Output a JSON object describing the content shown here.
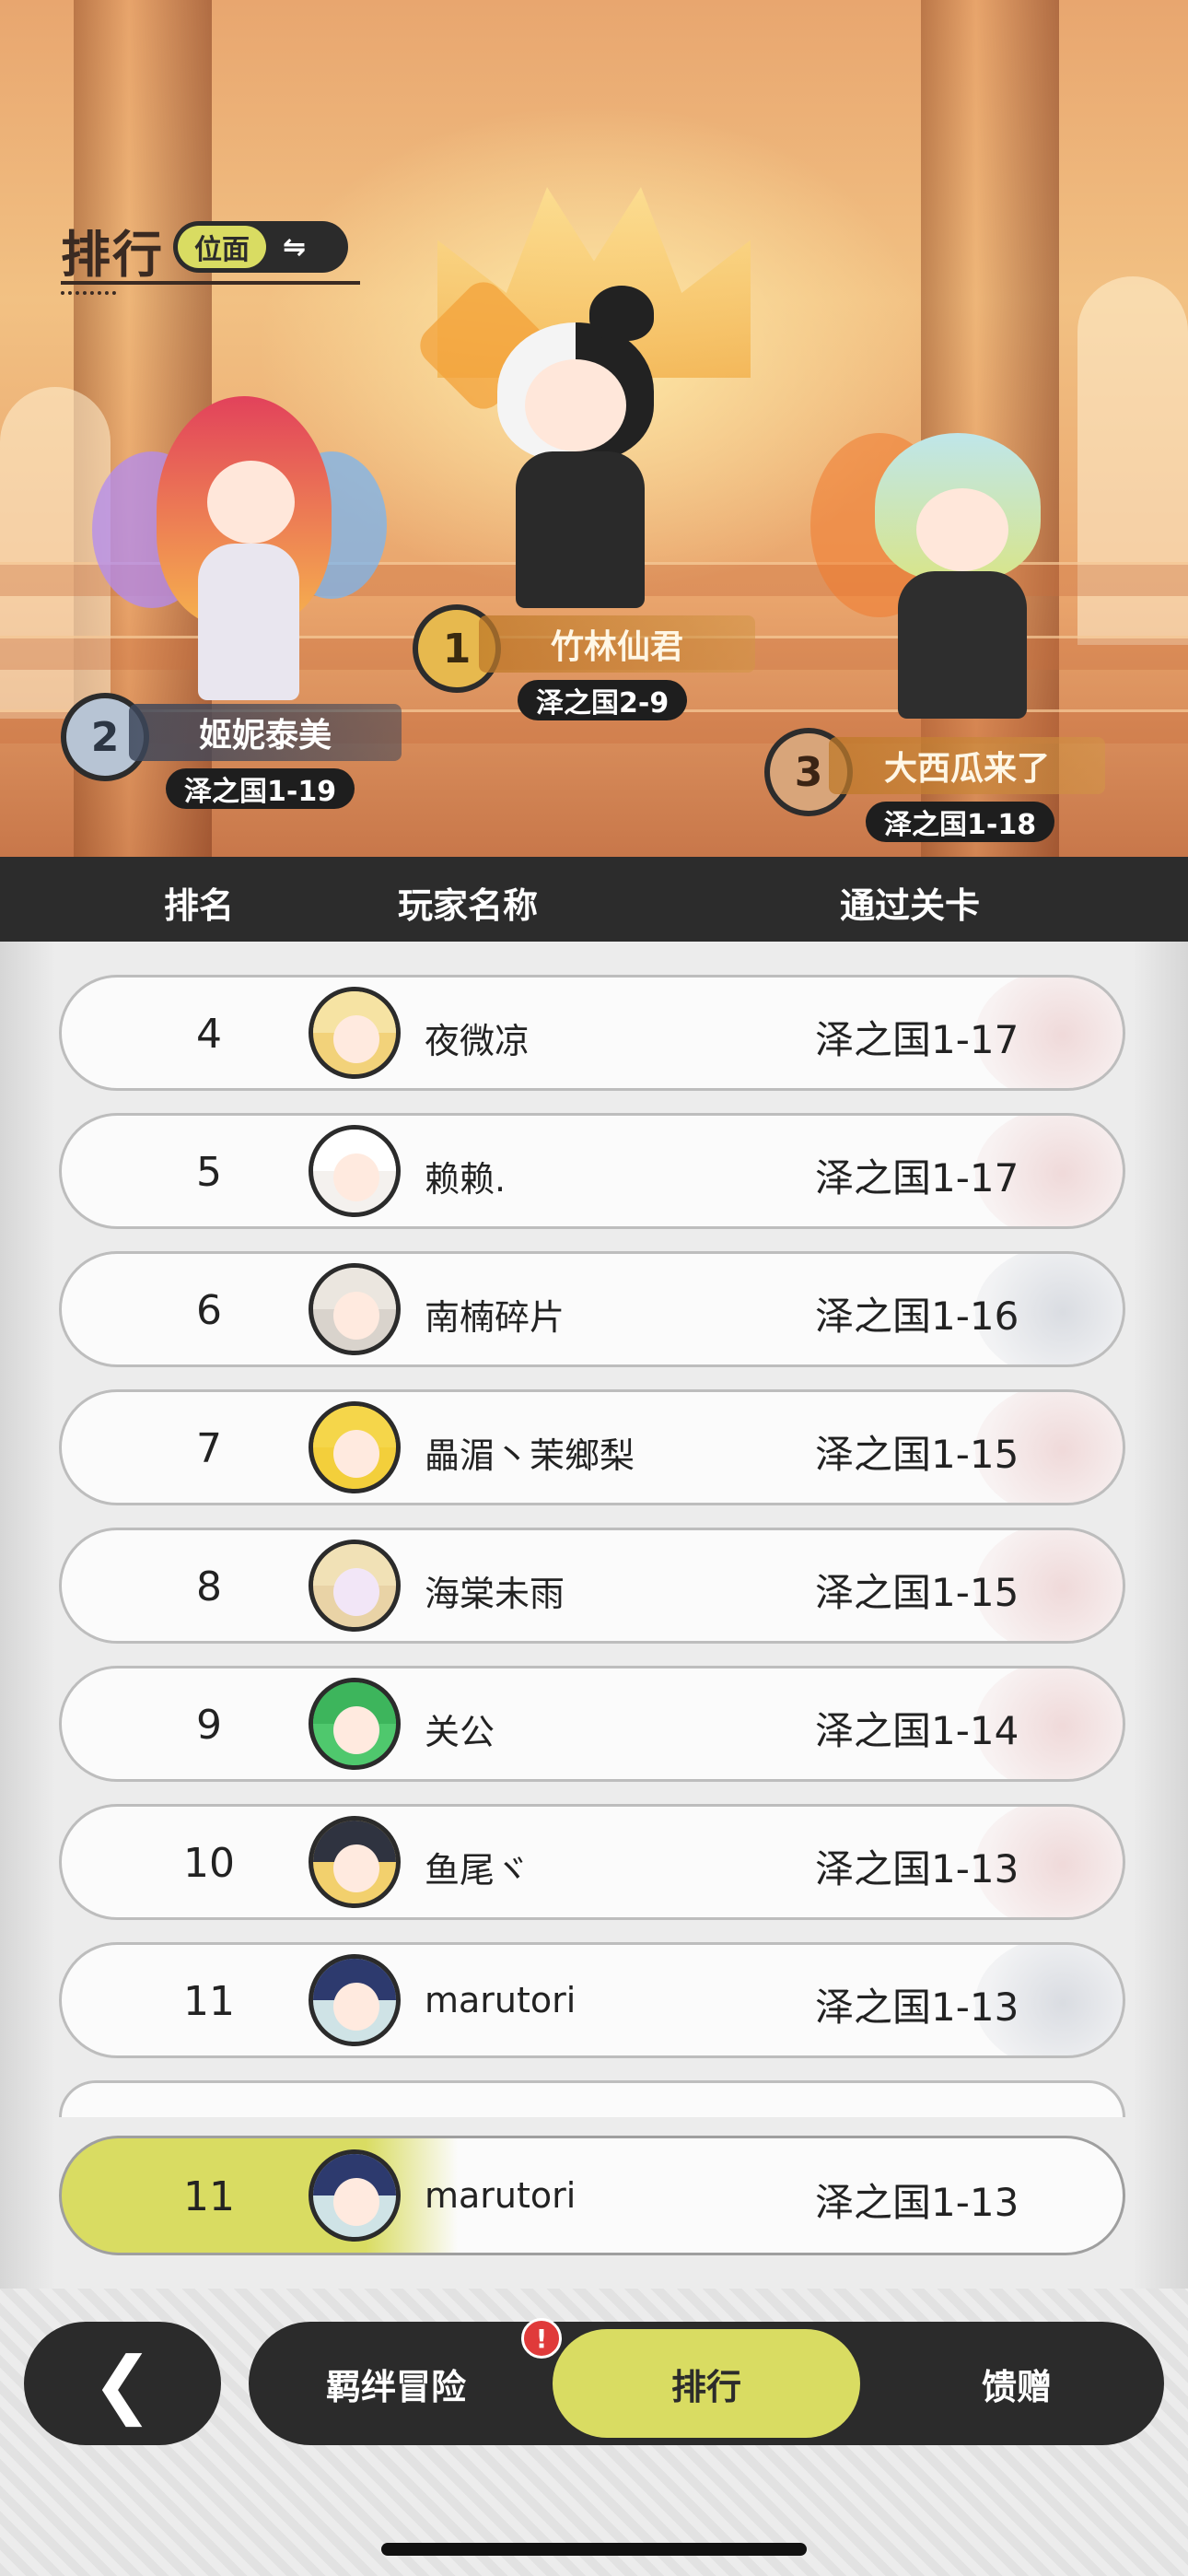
{
  "header": {
    "title": "排行",
    "scope": "位面",
    "swap_icon": "swap-arrows-icon"
  },
  "podium": [
    {
      "rank": "1",
      "name": "竹林仙君",
      "stage": "泽之国2-9"
    },
    {
      "rank": "2",
      "name": "姬妮泰美",
      "stage": "泽之国1-19"
    },
    {
      "rank": "3",
      "name": "大西瓜来了",
      "stage": "泽之国1-18"
    }
  ],
  "columns": {
    "rank": "排名",
    "player": "玩家名称",
    "stage": "通过关卡"
  },
  "rows": [
    {
      "rank": "4",
      "name": "夜微凉",
      "stage": "泽之国1-17",
      "avatar_color": "#f2d27a"
    },
    {
      "rank": "5",
      "name": "赖赖.",
      "stage": "泽之国1-17",
      "avatar_color": "#f4f1ee"
    },
    {
      "rank": "6",
      "name": "南楠碎片",
      "stage": "泽之国1-16",
      "avatar_color": "#d9d3cc"
    },
    {
      "rank": "7",
      "name": "畾湄丶茉鄉梨",
      "stage": "泽之国1-15",
      "avatar_color": "#f3cf3b"
    },
    {
      "rank": "8",
      "name": "海棠未雨",
      "stage": "泽之国1-15",
      "avatar_color": "#e9d3a6"
    },
    {
      "rank": "9",
      "name": "关公",
      "stage": "泽之国1-14",
      "avatar_color": "#4fc86d"
    },
    {
      "rank": "10",
      "name": "鱼尾ヾ",
      "stage": "泽之国1-13",
      "avatar_color": "#f2d06d"
    },
    {
      "rank": "11",
      "name": "marutori",
      "stage": "泽之国1-13",
      "avatar_color": "#2d3a6e"
    }
  ],
  "self": {
    "rank": "11",
    "name": "marutori",
    "stage": "泽之国1-13"
  },
  "nav": {
    "back_icon": "chevron-left-icon",
    "tabs": [
      "羁绊冒险",
      "排行",
      "馈赠"
    ],
    "active_tab": "排行",
    "badge": "!"
  },
  "colors": {
    "accent": "#d9dc62",
    "dark": "#2b2b2b"
  }
}
